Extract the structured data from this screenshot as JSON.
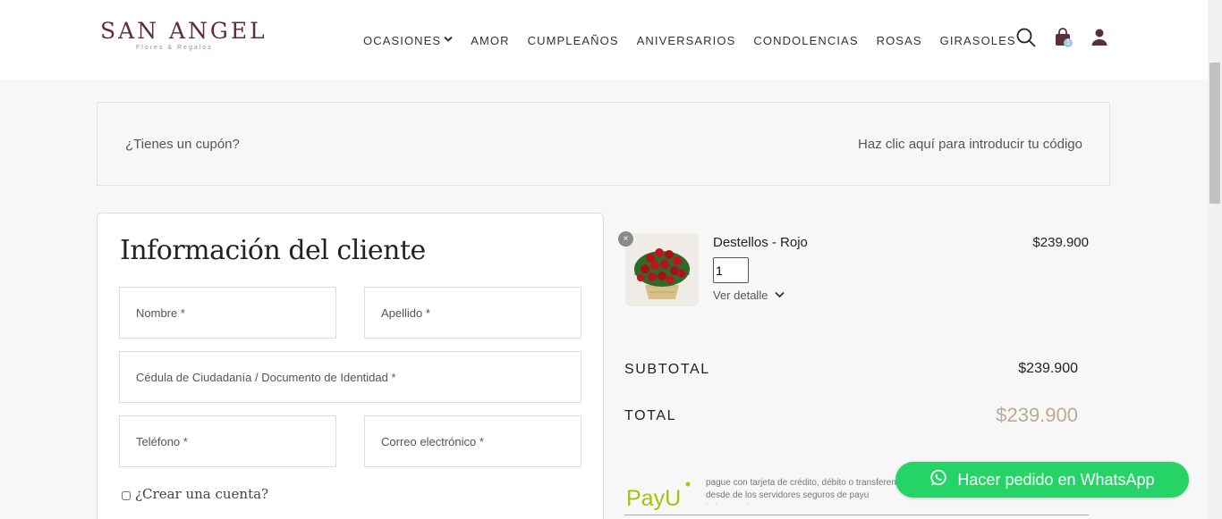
{
  "brand": {
    "name": "SAN ANGEL",
    "tagline": "Flores & Regalos",
    "color": "#5b2e38"
  },
  "nav": {
    "items": [
      {
        "label": "OCASIONES",
        "has_dropdown": true
      },
      {
        "label": "AMOR"
      },
      {
        "label": "CUMPLEAÑOS"
      },
      {
        "label": "ANIVERSARIOS"
      },
      {
        "label": "CONDOLENCIAS"
      },
      {
        "label": "ROSAS"
      },
      {
        "label": "GIRASOLES"
      }
    ],
    "icons": [
      "search-icon",
      "shopping-bag-icon",
      "user-icon"
    ],
    "cart_count": "1"
  },
  "coupon": {
    "question": "¿Tienes un cupón?",
    "link": "Haz clic aquí para introducir tu código"
  },
  "customer_form": {
    "title": "Información del cliente",
    "fields": {
      "first_name": "Nombre *",
      "last_name": "Apellido *",
      "document": "Cédula de Ciudadanía / Documento de Identidad *",
      "phone": "Teléfono *",
      "email": "Correo electrónico *"
    },
    "create_account": "¿Crear una cuenta?"
  },
  "order": {
    "product": {
      "name": "Destellos - Rojo",
      "price": "$239.900",
      "quantity": "1",
      "detail_label": "Ver detalle",
      "remove_label": "×"
    },
    "subtotal_label": "SUBTOTAL",
    "subtotal_value": "$239.900",
    "total_label": "TOTAL",
    "total_value": "$239.900",
    "total_color": "#b7ab98"
  },
  "payment": {
    "provider": "PayU",
    "description": "pague con tarjeta de crédito, débito o transferencia desde de los servidores seguros de payu latinoamerica"
  },
  "whatsapp": {
    "label": "Hacer pedido en WhatsApp",
    "color": "#25d366"
  }
}
